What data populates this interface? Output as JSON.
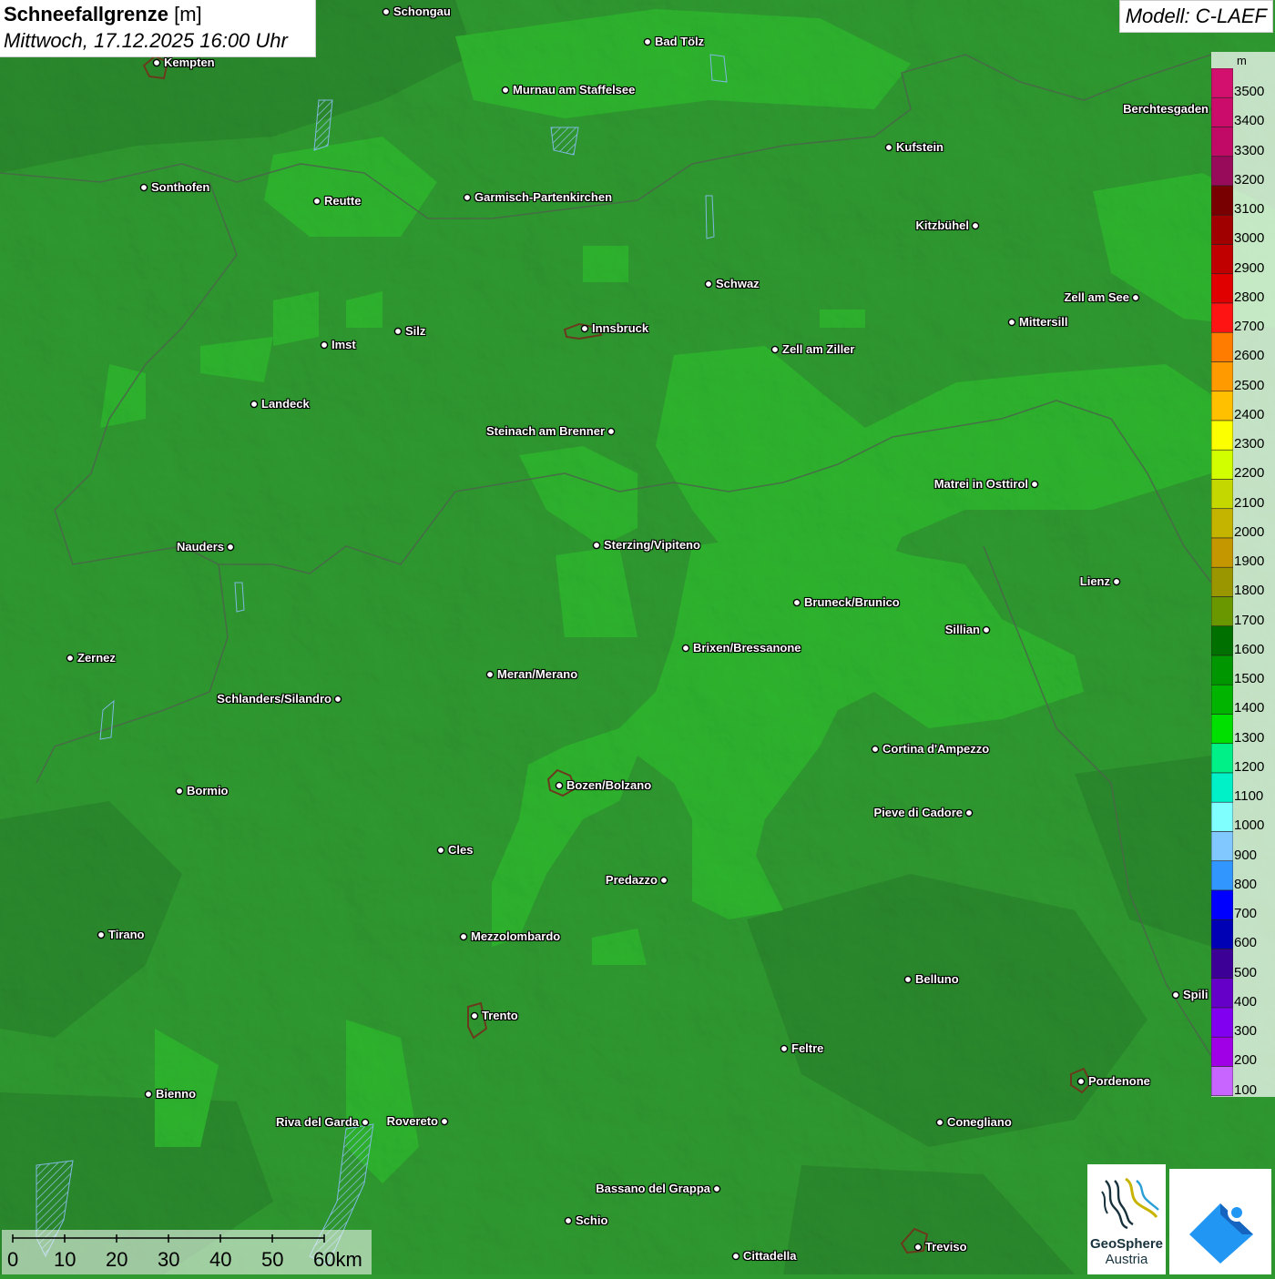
{
  "header": {
    "parameter": "Schneefallgrenze",
    "unit": "[m]",
    "datetime": "Mittwoch, 17.12.2025 16:00 Uhr",
    "model": "Modell: C-LAEF"
  },
  "legend": {
    "unit": "m",
    "levels": [
      {
        "label": "3500",
        "color": "#d4106e"
      },
      {
        "label": "3400",
        "color": "#cc0c6a"
      },
      {
        "label": "3300",
        "color": "#c00a66"
      },
      {
        "label": "3200",
        "color": "#980a5a"
      },
      {
        "label": "3100",
        "color": "#780000"
      },
      {
        "label": "3000",
        "color": "#a00000"
      },
      {
        "label": "2900",
        "color": "#c00000"
      },
      {
        "label": "2800",
        "color": "#e00000"
      },
      {
        "label": "2700",
        "color": "#ff1414"
      },
      {
        "label": "2600",
        "color": "#ff7c00"
      },
      {
        "label": "2500",
        "color": "#ff9a00"
      },
      {
        "label": "2400",
        "color": "#ffc000"
      },
      {
        "label": "2300",
        "color": "#fcff00"
      },
      {
        "label": "2200",
        "color": "#d2ff00"
      },
      {
        "label": "2100",
        "color": "#c4d800"
      },
      {
        "label": "2000",
        "color": "#c4b400"
      },
      {
        "label": "1900",
        "color": "#c49600"
      },
      {
        "label": "1800",
        "color": "#9a9600"
      },
      {
        "label": "1700",
        "color": "#6a9600"
      },
      {
        "label": "1600",
        "color": "#007000"
      },
      {
        "label": "1500",
        "color": "#009600"
      },
      {
        "label": "1400",
        "color": "#00b400"
      },
      {
        "label": "1300",
        "color": "#00e000"
      },
      {
        "label": "1200",
        "color": "#00f088"
      },
      {
        "label": "1100",
        "color": "#00f0c8"
      },
      {
        "label": "1000",
        "color": "#80ffff"
      },
      {
        "label": "900",
        "color": "#80c8ff"
      },
      {
        "label": "800",
        "color": "#3296ff"
      },
      {
        "label": "700",
        "color": "#0000ff"
      },
      {
        "label": "600",
        "color": "#0000b4"
      },
      {
        "label": "500",
        "color": "#3c0096"
      },
      {
        "label": "400",
        "color": "#6400c8"
      },
      {
        "label": "300",
        "color": "#8200f0"
      },
      {
        "label": "200",
        "color": "#a000e6"
      },
      {
        "label": "100",
        "color": "#c864ff"
      }
    ]
  },
  "cities": [
    {
      "name": "Schongau",
      "align": "right"
    },
    {
      "name": "Bad Tölz",
      "align": "right"
    },
    {
      "name": "Kempten",
      "align": "right",
      "capital": true
    },
    {
      "name": "Murnau am Staffelsee",
      "align": "right"
    },
    {
      "name": "Berchtesgaden",
      "align": "left"
    },
    {
      "name": "Kufstein",
      "align": "right"
    },
    {
      "name": "Sonthofen",
      "align": "right"
    },
    {
      "name": "Reutte",
      "align": "right"
    },
    {
      "name": "Garmisch-Partenkirchen",
      "align": "right"
    },
    {
      "name": "Kitzbühel",
      "align": "left"
    },
    {
      "name": "Schwaz",
      "align": "right"
    },
    {
      "name": "Zell am See",
      "align": "left"
    },
    {
      "name": "Mittersill",
      "align": "right"
    },
    {
      "name": "Innsbruck",
      "align": "right",
      "capital": true
    },
    {
      "name": "Silz",
      "align": "right"
    },
    {
      "name": "Imst",
      "align": "right"
    },
    {
      "name": "Zell am Ziller",
      "align": "right"
    },
    {
      "name": "Landeck",
      "align": "right"
    },
    {
      "name": "Steinach am Brenner",
      "align": "left"
    },
    {
      "name": "Matrei in Osttirol",
      "align": "left"
    },
    {
      "name": "Nauders",
      "align": "left"
    },
    {
      "name": "Sterzing/Vipiteno",
      "align": "right"
    },
    {
      "name": "Lienz",
      "align": "left"
    },
    {
      "name": "Bruneck/Brunico",
      "align": "right"
    },
    {
      "name": "Sillian",
      "align": "left"
    },
    {
      "name": "Brixen/Bressanone",
      "align": "right"
    },
    {
      "name": "Zernez",
      "align": "right"
    },
    {
      "name": "Meran/Merano",
      "align": "right"
    },
    {
      "name": "Schlanders/Silandro",
      "align": "left"
    },
    {
      "name": "Cortina d'Ampezzo",
      "align": "right"
    },
    {
      "name": "Bozen/Bolzano",
      "align": "right",
      "capital": true
    },
    {
      "name": "Bormio",
      "align": "right"
    },
    {
      "name": "Pieve di Cadore",
      "align": "left"
    },
    {
      "name": "Cles",
      "align": "right"
    },
    {
      "name": "Predazzo",
      "align": "left"
    },
    {
      "name": "Tirano",
      "align": "right"
    },
    {
      "name": "Mezzolombardo",
      "align": "right"
    },
    {
      "name": "Belluno",
      "align": "right"
    },
    {
      "name": "Spili",
      "align": "right"
    },
    {
      "name": "Trento",
      "align": "right",
      "capital": true
    },
    {
      "name": "Feltre",
      "align": "right"
    },
    {
      "name": "Pordenone",
      "align": "right",
      "capital": true
    },
    {
      "name": "Bienno",
      "align": "right"
    },
    {
      "name": "Riva del Garda",
      "align": "left"
    },
    {
      "name": "Rovereto",
      "align": "left"
    },
    {
      "name": "Conegliano",
      "align": "right"
    },
    {
      "name": "Bassano del Grappa",
      "align": "left"
    },
    {
      "name": "Schio",
      "align": "right"
    },
    {
      "name": "Treviso",
      "align": "right",
      "capital": true
    },
    {
      "name": "Cittadella",
      "align": "right"
    }
  ],
  "scalebar": {
    "labels": [
      "0",
      "10",
      "20",
      "30",
      "40",
      "50",
      "60km"
    ]
  },
  "logos": {
    "geosphere_name": "GeoSphere",
    "geosphere_sub": "Austria"
  },
  "colors": {
    "base_field": "#2f9a30",
    "field_1400": "#2eb52e",
    "field_1600": "#2a8a2c",
    "water": "#7fb8e0",
    "border": "#3d5a3d"
  }
}
